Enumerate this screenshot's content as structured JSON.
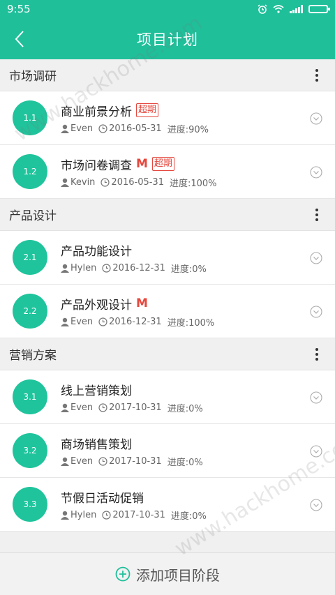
{
  "status": {
    "time": "9:55"
  },
  "header": {
    "title": "项目计划"
  },
  "sections": [
    {
      "title": "市场调研",
      "tasks": [
        {
          "num": "1.1",
          "title": "商业前景分析",
          "milestone": "",
          "overdue": "超期",
          "owner": "Even",
          "date": "2016-05-31",
          "progress": "进度:90%"
        },
        {
          "num": "1.2",
          "title": "市场问卷调查",
          "milestone": "M",
          "overdue": "超期",
          "owner": "Kevin",
          "date": "2016-05-31",
          "progress": "进度:100%"
        }
      ]
    },
    {
      "title": "产品设计",
      "tasks": [
        {
          "num": "2.1",
          "title": "产品功能设计",
          "milestone": "",
          "overdue": "",
          "owner": "Hylen",
          "date": "2016-12-31",
          "progress": "进度:0%"
        },
        {
          "num": "2.2",
          "title": "产品外观设计",
          "milestone": "M",
          "overdue": "",
          "owner": "Even",
          "date": "2016-12-31",
          "progress": "进度:100%"
        }
      ]
    },
    {
      "title": "营销方案",
      "tasks": [
        {
          "num": "3.1",
          "title": "线上营销策划",
          "milestone": "",
          "overdue": "",
          "owner": "Even",
          "date": "2017-10-31",
          "progress": "进度:0%"
        },
        {
          "num": "3.2",
          "title": "商场销售策划",
          "milestone": "",
          "overdue": "",
          "owner": "Even",
          "date": "2017-10-31",
          "progress": "进度:0%"
        },
        {
          "num": "3.3",
          "title": "节假日活动促销",
          "milestone": "",
          "overdue": "",
          "owner": "Hylen",
          "date": "2017-10-31",
          "progress": "进度:0%"
        }
      ]
    }
  ],
  "footer": {
    "add_label": "添加项目阶段"
  },
  "watermark": "www.hackhome.com",
  "colors": {
    "accent": "#1fbf9a",
    "badge": "#1fc49c",
    "alert": "#e5483e"
  },
  "icons": {
    "back": "chevron-left-icon",
    "more": "more-vertical-icon",
    "user": "user-icon",
    "clock": "clock-icon",
    "expand": "chevron-down-circle-icon",
    "add": "plus-circle-icon"
  }
}
